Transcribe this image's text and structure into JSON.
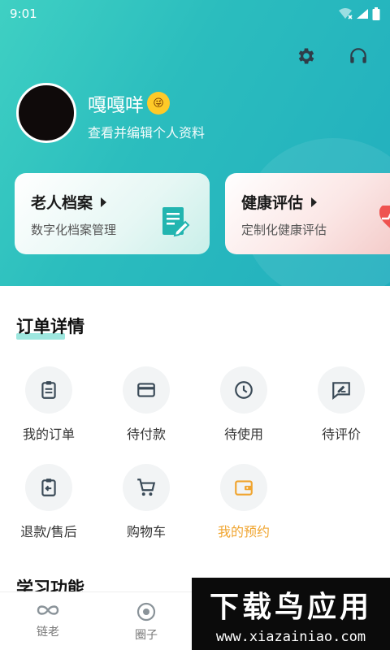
{
  "status_bar": {
    "time": "9:01"
  },
  "profile": {
    "name": "嘎嘎咩",
    "emoji": "😜",
    "subtitle": "查看并编辑个人资料"
  },
  "cards": [
    {
      "title": "老人档案",
      "subtitle": "数字化档案管理",
      "icon": "document-edit-icon"
    },
    {
      "title": "健康评估",
      "subtitle": "定制化健康评估",
      "icon": "heart-pulse-icon"
    }
  ],
  "orders": {
    "title": "订单详情",
    "items": [
      {
        "label": "我的订单",
        "icon": "clipboard-list-icon"
      },
      {
        "label": "待付款",
        "icon": "credit-card-icon"
      },
      {
        "label": "待使用",
        "icon": "clock-icon"
      },
      {
        "label": "待评价",
        "icon": "review-icon"
      },
      {
        "label": "退款/售后",
        "icon": "refund-icon"
      },
      {
        "label": "购物车",
        "icon": "cart-icon"
      },
      {
        "label": "我的预约",
        "icon": "wallet-icon"
      }
    ]
  },
  "learning": {
    "title": "学习功能"
  },
  "bottom_nav": [
    {
      "label": "链老",
      "icon": "link-icon"
    },
    {
      "label": "圈子",
      "icon": "circle-dot-icon"
    }
  ],
  "watermark": {
    "main": "下载鸟应用",
    "url": "www.xiazainiao.com"
  },
  "colors": {
    "primary": "#2bbdbe",
    "accent": "#f0a530",
    "icon_dark": "#3a4a57"
  }
}
